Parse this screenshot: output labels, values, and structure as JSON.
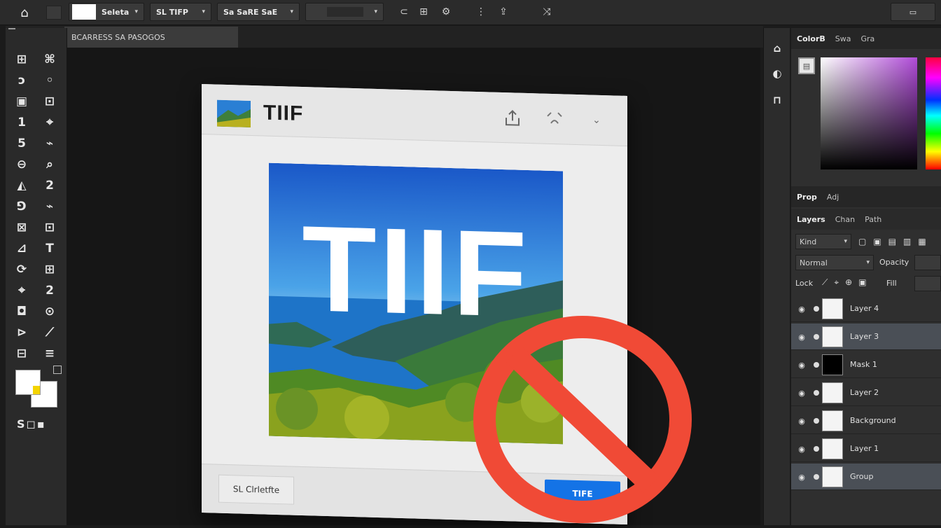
{
  "options_bar": {
    "home_glyph": "⌂",
    "mode": "Seleta",
    "preset": "SL TIFP",
    "style": "Sa SaRE SaE",
    "workspace": "▭"
  },
  "document": {
    "tab_title": "BCARRESS SA PASOGOS"
  },
  "toolbar": {
    "tools": [
      [
        "⊞",
        "⌘"
      ],
      [
        "ↄ",
        "◦"
      ],
      [
        "▣",
        "⊡"
      ],
      [
        "1",
        "⌖"
      ],
      [
        "5",
        "⌁"
      ],
      [
        "⊖",
        "⌕"
      ],
      [
        "◭",
        "2"
      ],
      [
        "⅁",
        "⌁"
      ],
      [
        "⊠",
        "⊡"
      ],
      [
        "⊿",
        "T"
      ],
      [
        "⟳",
        "⊞"
      ],
      [
        "⌖",
        "2"
      ],
      [
        "◘",
        "⊙"
      ],
      [
        "⊳",
        "⟋"
      ],
      [
        "⊟",
        "≡"
      ]
    ],
    "bottom_glyph": "S◻▪"
  },
  "dialog": {
    "title": "TIIF",
    "preview_text": "TIIF",
    "secondary_button": "SL Clrletfte",
    "primary_button": "TIFE"
  },
  "dock": {
    "icons": [
      "⌂",
      "◐",
      "⊓"
    ]
  },
  "right_panel": {
    "color_tabs": [
      "ColorB",
      "Swa",
      "Gra"
    ],
    "properties_tabs": [
      "Prop",
      "Adj"
    ],
    "layers_tabs": [
      "Layers",
      "Chan",
      "Path"
    ],
    "kind_filter": "Kind",
    "blend_mode": "Normal",
    "opacity_label": "Opacity",
    "lock_label": "Lock",
    "fill_label": "Fill",
    "layers": [
      {
        "name": "Layer 4",
        "selected": false
      },
      {
        "name": "Layer 3",
        "selected": true
      },
      {
        "name": "Mask 1",
        "selected": false
      },
      {
        "name": "Layer 2",
        "selected": false
      },
      {
        "name": "Background",
        "selected": false
      },
      {
        "name": "Layer 1",
        "selected": false
      },
      {
        "name": "Group",
        "selected": true
      }
    ]
  },
  "colors": {
    "prohibition_red": "#f04a36",
    "accent_blue": "#1473e6",
    "panel_bg": "#2f2f2f"
  }
}
